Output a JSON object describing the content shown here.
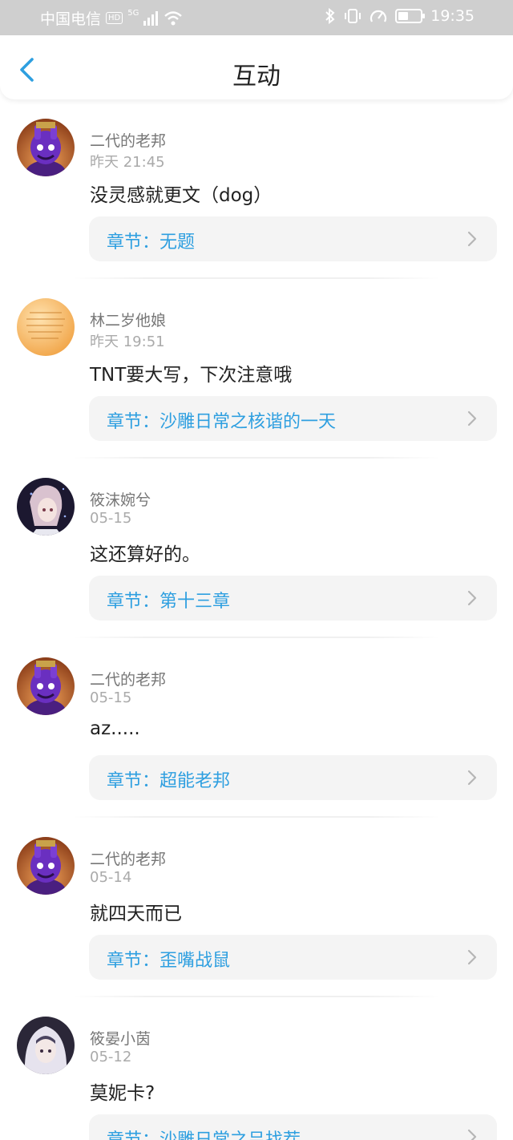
{
  "status_bar": {
    "carrier": "中国电信",
    "hd_badge": "HD",
    "network": "5G",
    "time": "19:35",
    "icons": [
      "signal-icon",
      "wifi-icon",
      "bluetooth-icon",
      "vibrate-icon",
      "speedometer-icon",
      "battery-icon"
    ],
    "battery_level": 0.45
  },
  "header": {
    "title": "互动",
    "back_icon": "back-chevron-icon"
  },
  "colors": {
    "accent": "#2e9fe0",
    "card_bg": "#f4f4f4",
    "status_bg": "#cfcfcf"
  },
  "comments": [
    {
      "username": "二代的老邦",
      "time": "昨天 21:45",
      "content": "没灵感就更文（dog）",
      "chapter": "章节：无题",
      "avatar": "purple-character-avatar"
    },
    {
      "username": "林二岁他娘",
      "time": "昨天 19:51",
      "content": "TNT要大写，下次注意哦",
      "chapter": "章节：沙雕日常之核谐的一天",
      "avatar": "orange-paper-avatar"
    },
    {
      "username": "筱沫婉兮",
      "time": "05-15",
      "content": "这还算好的。",
      "chapter": "章节：第十三章",
      "avatar": "anime-character-avatar"
    },
    {
      "username": "二代的老邦",
      "time": "05-15",
      "content": "az.....",
      "chapter": "章节：超能老邦",
      "avatar": "purple-character-avatar"
    },
    {
      "username": "二代的老邦",
      "time": "05-14",
      "content": "就四天而已",
      "chapter": "章节：歪嘴战鼠",
      "avatar": "purple-character-avatar"
    },
    {
      "username": "筱晏小茵",
      "time": "05-12",
      "content": "莫妮卡?",
      "chapter": "章节：沙雕日常之吕找茬",
      "avatar": "hooded-character-avatar"
    }
  ]
}
